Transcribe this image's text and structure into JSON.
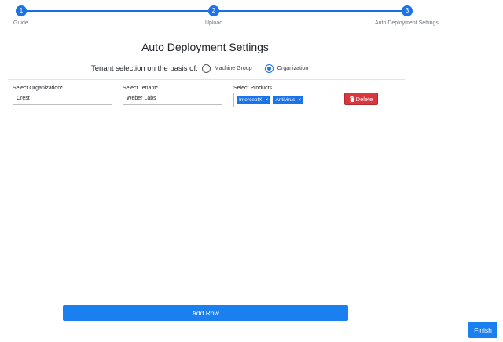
{
  "stepper": {
    "steps": [
      {
        "number": "1",
        "label": "Guide"
      },
      {
        "number": "2",
        "label": "Upload"
      },
      {
        "number": "3",
        "label": "Auto Deployment Settings"
      }
    ],
    "accent": "#1a73e8"
  },
  "page": {
    "title": "Auto Deployment Settings"
  },
  "tenant_selection": {
    "label": "Tenant selection on the basis of:",
    "options": [
      {
        "label": "Machine Group",
        "selected": false
      },
      {
        "label": "Organization",
        "selected": true
      }
    ]
  },
  "row": {
    "organization": {
      "label": "Select Organization*",
      "value": "Crest"
    },
    "tenant": {
      "label": "Select Tenant*",
      "value": "Weber Labs"
    },
    "products": {
      "label": "Select Products",
      "tags": [
        {
          "label": "InterceptX",
          "remove": "×"
        },
        {
          "label": "Antivirus",
          "remove": "×"
        }
      ]
    },
    "delete_label": "Delete",
    "delete_icon": "trash-icon",
    "delete_color": "#d9363e"
  },
  "actions": {
    "add_row_label": "Add Row",
    "finish_label": "Finish",
    "primary_color": "#1a80f0"
  }
}
